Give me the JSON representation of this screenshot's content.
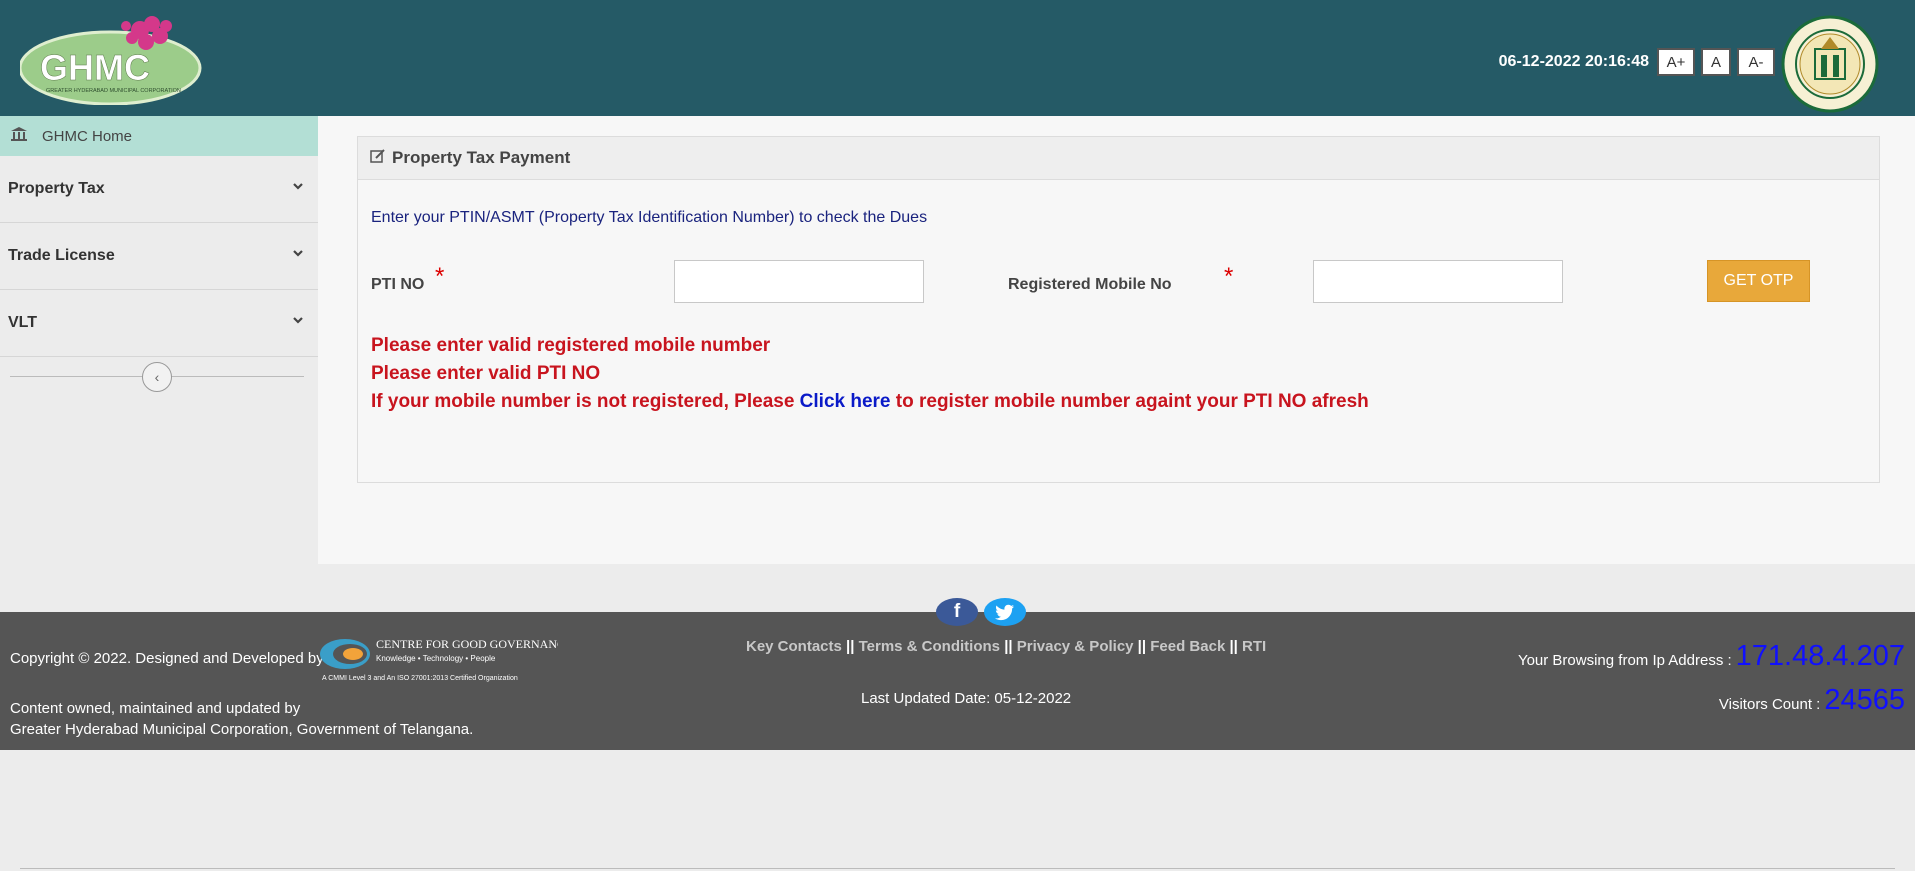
{
  "header": {
    "logo_text": "GHMC",
    "logo_subtitle": "GREATER HYDERABAD MUNICIPAL CORPORATION",
    "datetime": "06-12-2022 20:16:48",
    "font_buttons": [
      "A+",
      "A",
      "A-"
    ],
    "emblem_text": "GOVERNMENT OF TELANGANA",
    "colors": {
      "background": "#255a66"
    }
  },
  "sidebar": {
    "home_label": "GHMC Home",
    "items": [
      {
        "label": "Property Tax"
      },
      {
        "label": "Trade License"
      },
      {
        "label": "VLT"
      }
    ]
  },
  "panel": {
    "title": "Property Tax Payment",
    "intro": "Enter your PTIN/ASMT (Property Tax Identification Number) to check the Dues",
    "pti_label": "PTI NO",
    "mobile_label": "Registered Mobile No",
    "required_mark": "*",
    "pti_value": "",
    "mobile_value": "",
    "otp_button": "GET OTP",
    "errors": {
      "mobile": "Please enter valid registered mobile number",
      "pti": "Please enter valid PTI NO",
      "register_prefix": "If your mobile number is not registered, Please ",
      "register_link": "Click here",
      "register_suffix": " to register mobile number againt your PTI NO afresh"
    },
    "colors": {
      "button": "#e8a83a",
      "error": "#c8141e",
      "link": "#0a1ac8"
    }
  },
  "footer": {
    "copyright": "Copyright © 2022. Designed and Developed by",
    "cgg_name": "CENTRE FOR GOOD GOVERNANCE",
    "cgg_tagline": "Knowledge • Technology • People",
    "cgg_cert": "A CMMI Level 3 and An ISO 27001:2013 Certified Organization",
    "owned_line1": "Content owned, maintained and updated by",
    "owned_line2": "Greater Hyderabad Municipal Corporation, Government of Telangana.",
    "links": [
      "Key Contacts",
      "Terms & Conditions",
      "Privacy & Policy",
      "Feed Back",
      "RTI"
    ],
    "separator": "||",
    "last_updated": "Last Updated Date: 05-12-2022",
    "ip_label": "Your Browsing from Ip Address :",
    "ip_value": "171.48.4.207",
    "visitors_label": "Visitors Count :",
    "visitors_value": "24565",
    "social": [
      "facebook-icon",
      "twitter-icon"
    ]
  }
}
